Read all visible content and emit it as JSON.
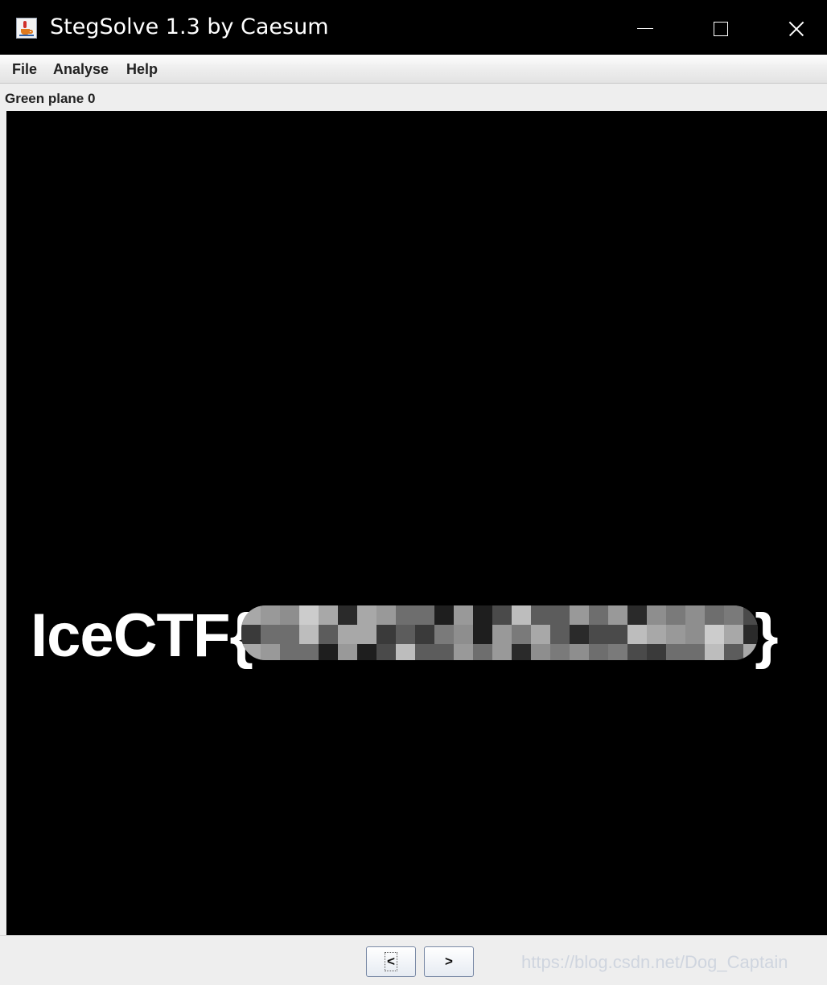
{
  "window": {
    "title": "StegSolve 1.3 by Caesum"
  },
  "menu": {
    "file": "File",
    "analyse": "Analyse",
    "help": "Help"
  },
  "plane": {
    "label": "Green plane 0"
  },
  "image": {
    "flag_prefix": "IceCTF{",
    "flag_suffix": "}"
  },
  "nav": {
    "prev_label": "<",
    "next_label": ">"
  },
  "watermark": "https://blog.csdn.net/Dog_Captain",
  "colors": {
    "titlebar": "#000000",
    "panel": "#eeeeee",
    "image_bg": "#000000"
  }
}
